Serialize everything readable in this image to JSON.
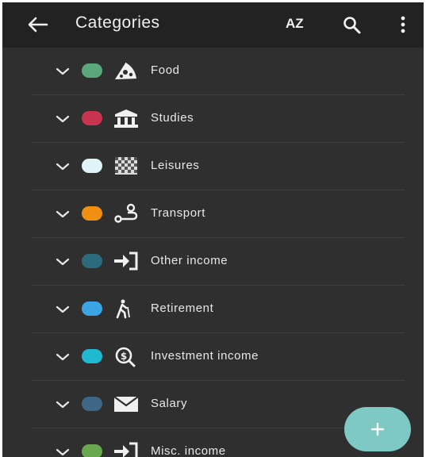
{
  "app_bar": {
    "title": "Categories",
    "sort_label": "AZ",
    "icons": [
      "back-arrow-icon",
      "search-icon",
      "more-vert-icon"
    ]
  },
  "categories": [
    {
      "label": "Food",
      "color": "#5aa87b",
      "icon": "pizza-icon"
    },
    {
      "label": "Studies",
      "color": "#c8334f",
      "icon": "bank-building-icon"
    },
    {
      "label": "Leisures",
      "color": "#dff4f8",
      "icon": "checkered-flag-icon"
    },
    {
      "label": "Transport",
      "color": "#f18f12",
      "icon": "route-icon"
    },
    {
      "label": "Other income",
      "color": "#2b6b7c",
      "icon": "login-arrow-icon"
    },
    {
      "label": "Retirement",
      "color": "#3aa5e2",
      "icon": "elderly-walking-icon"
    },
    {
      "label": "Investment income",
      "color": "#1fb9d0",
      "icon": "money-search-icon"
    },
    {
      "label": "Salary",
      "color": "#3f6684",
      "icon": "envelope-icon"
    },
    {
      "label": "Misc. income",
      "color": "#69a84e",
      "icon": "login-arrow-icon"
    }
  ],
  "fab": {
    "icon": "plus-icon",
    "color": "#7fc9c4"
  }
}
